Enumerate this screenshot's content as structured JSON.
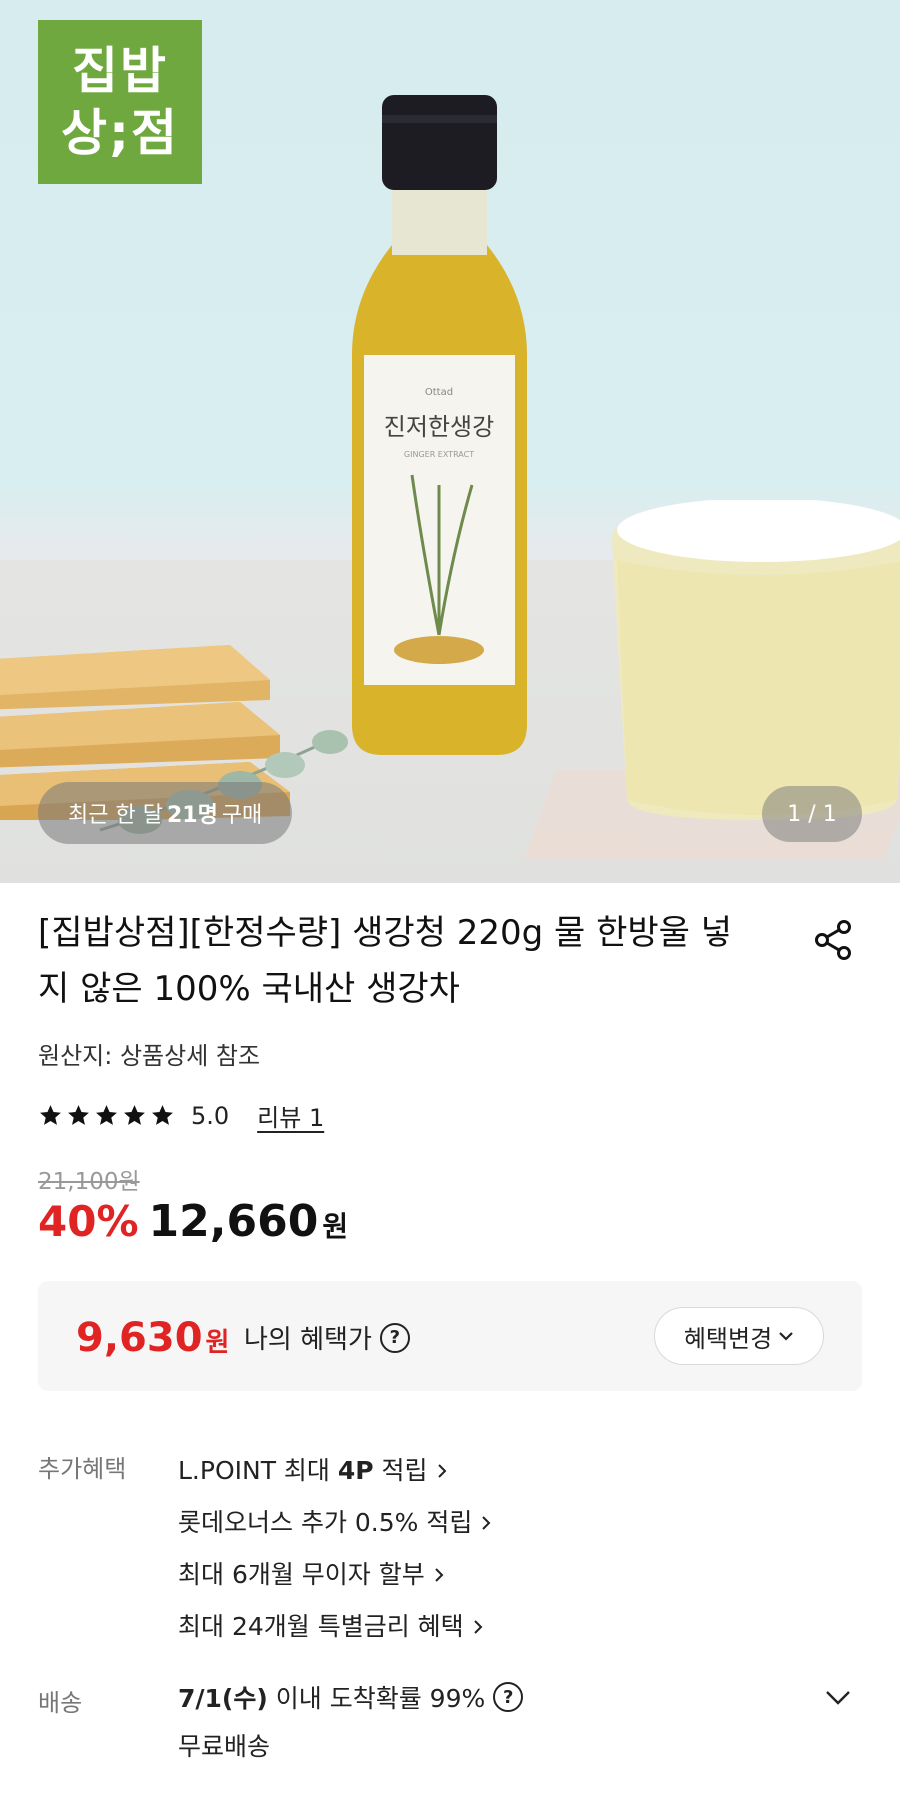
{
  "hero": {
    "brand_logo_line1": "집밥",
    "brand_logo_line2": "상;점",
    "bottle_label_brand": "Ottad",
    "bottle_label_title": "진저한생강",
    "bottle_label_sub": "GINGER EXTRACT",
    "buyers_prefix": "최근 한 달",
    "buyers_count": "21명",
    "buyers_suffix": "구매",
    "page_counter": "1 / 1"
  },
  "product": {
    "title": "[집밥상점][한정수량] 생강청 220g 물 한방울 넣지 않은 100% 국내산 생강차",
    "origin": "원산지: 상품상세 참조",
    "rating": "5.0",
    "stars": 5,
    "review_link": "리뷰 1",
    "original_price": "21,100원",
    "discount": "40%",
    "price": "12,660",
    "price_unit": "원"
  },
  "benefit_box": {
    "price": "9,630",
    "price_unit": "원",
    "label": "나의 혜택가",
    "change_button": "혜택변경"
  },
  "additional_benefits": {
    "label": "추가혜택",
    "items": [
      {
        "pre": "L.POINT 최대 ",
        "bold": "4P",
        "post": " 적립"
      },
      {
        "pre": "롯데오너스 추가 0.5% 적립",
        "bold": "",
        "post": ""
      },
      {
        "pre": "최대 6개월 무이자 할부",
        "bold": "",
        "post": ""
      },
      {
        "pre": "최대 24개월 특별금리 혜택",
        "bold": "",
        "post": ""
      }
    ]
  },
  "delivery": {
    "label": "배송",
    "date": "7/1(수)",
    "text": "이내 도착확률 99%",
    "free": "무료배송"
  },
  "colors": {
    "accent_red": "#e02424",
    "brand_green": "#6fa83e"
  }
}
